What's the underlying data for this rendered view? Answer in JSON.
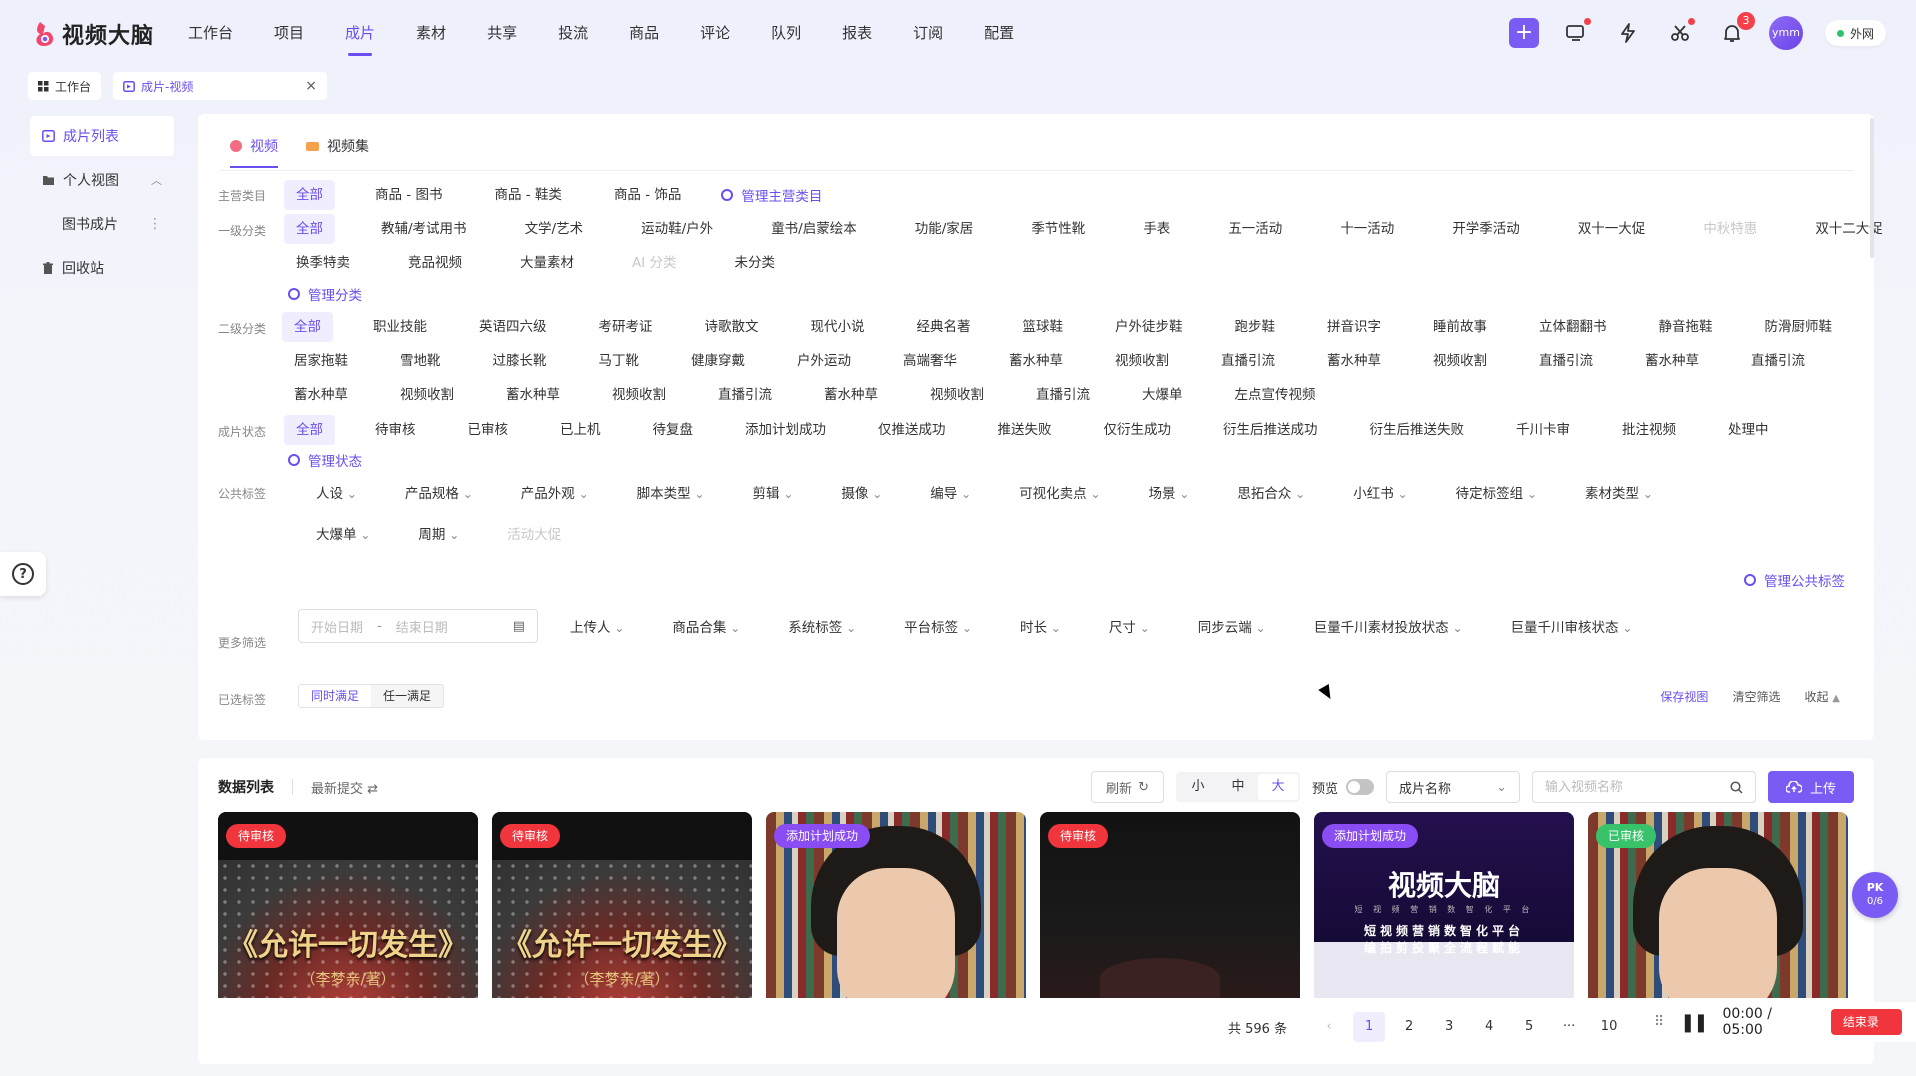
{
  "app": {
    "logo_text": "视频大脑"
  },
  "nav": [
    "工作台",
    "项目",
    "成片",
    "素材",
    "共享",
    "投流",
    "商品",
    "评论",
    "队列",
    "报表",
    "订阅",
    "配置"
  ],
  "nav_active": 2,
  "top": {
    "notif_count": "3",
    "avatar": "ymm",
    "network": "外网"
  },
  "tabs": [
    {
      "label": "工作台"
    },
    {
      "label": "成片-视频"
    }
  ],
  "sidebar": {
    "items": [
      {
        "label": "成片列表"
      },
      {
        "label": "个人视图"
      },
      {
        "label": "图书成片"
      },
      {
        "label": "回收站"
      }
    ]
  },
  "view_tabs": [
    "视频",
    "视频集"
  ],
  "filters": {
    "main_category": {
      "label": "主营类目",
      "options": [
        "全部",
        "商品 - 图书",
        "商品 - 鞋类",
        "商品 - 饰品"
      ],
      "manage": "管理主营类目"
    },
    "level1": {
      "label": "一级分类",
      "options": [
        "全部",
        "教辅/考试用书",
        "文学/艺术",
        "运动鞋/户外",
        "童书/启蒙绘本",
        "功能/家居",
        "季节性靴",
        "手表",
        "五一活动",
        "十一活动",
        "开学季活动",
        "双十一大促",
        "中秋特惠",
        "双十二大促",
        "换季特卖",
        "竞品视频",
        "大量素材",
        "AI 分类",
        "未分类"
      ],
      "manage": "管理分类"
    },
    "level2": {
      "label": "二级分类",
      "options": [
        "全部",
        "职业技能",
        "英语四六级",
        "考研考证",
        "诗歌散文",
        "现代小说",
        "经典名著",
        "篮球鞋",
        "户外徒步鞋",
        "跑步鞋",
        "拼音识字",
        "睡前故事",
        "立体翻翻书",
        "静音拖鞋",
        "防滑厨师鞋",
        "居家拖鞋",
        "雪地靴",
        "过膝长靴",
        "马丁靴",
        "健康穿戴",
        "户外运动",
        "高端奢华",
        "蓄水种草",
        "视频收割",
        "直播引流",
        "蓄水种草",
        "视频收割",
        "直播引流",
        "蓄水种草",
        "直播引流",
        "蓄水种草",
        "视频收割",
        "蓄水种草",
        "视频收割",
        "直播引流",
        "蓄水种草",
        "视频收割",
        "直播引流",
        "大爆单",
        "左点宣传视频"
      ]
    },
    "status": {
      "label": "成片状态",
      "options": [
        "全部",
        "待审核",
        "已审核",
        "已上机",
        "待复盘",
        "添加计划成功",
        "仅推送成功",
        "推送失败",
        "仅衍生成功",
        "衍生后推送成功",
        "衍生后推送失败",
        "千川卡审",
        "批注视频",
        "处理中"
      ],
      "manage": "管理状态"
    },
    "public_tags": {
      "label": "公共标签",
      "options": [
        "人设",
        "产品规格",
        "产品外观",
        "脚本类型",
        "剪辑",
        "摄像",
        "编导",
        "可视化卖点",
        "场景",
        "思拓合众",
        "小红书",
        "待定标签组",
        "素材类型",
        "大爆单",
        "周期",
        "活动大促"
      ],
      "manage": "管理公共标签"
    },
    "more": {
      "label": "更多筛选",
      "start_placeholder": "开始日期",
      "end_placeholder": "结束日期",
      "dash": "-",
      "options": [
        "上传人",
        "商品合集",
        "系统标签",
        "平台标签",
        "时长",
        "尺寸",
        "同步云端",
        "巨量千川素材投放状态",
        "巨量千川审核状态"
      ]
    },
    "selected": {
      "label": "已选标签",
      "modes": [
        "同时满足",
        "任一满足"
      ],
      "save": "保存视图",
      "clear": "清空筛选",
      "collapse": "收起"
    }
  },
  "list": {
    "title": "数据列表",
    "sort": "最新提交",
    "refresh": "刷新",
    "sizes": [
      "小",
      "中",
      "大"
    ],
    "preview": "预览",
    "field_select": "成片名称",
    "search_placeholder": "输入视频名称",
    "upload": "上传",
    "cards": [
      {
        "tag": "待审核",
        "title": "《允许一切发生》",
        "sub": "（李梦亲/著）"
      },
      {
        "tag": "待审核",
        "title": "《允许一切发生》",
        "sub": "（李梦亲/著）"
      },
      {
        "tag": "添加计划成功"
      },
      {
        "tag": "待审核"
      },
      {
        "tag": "添加计划成功",
        "logo": "视频大脑",
        "logo_sub": "短 视 频 营 销 数 智 化 平 台",
        "line1": "短视频营销数智化平台",
        "line2": "编拍剪投聚全流程赋能"
      },
      {
        "tag": "已审核"
      }
    ]
  },
  "pager": {
    "total": "共 596 条",
    "pages": [
      "1",
      "2",
      "3",
      "4",
      "5",
      "···",
      "10"
    ],
    "prev": "‹",
    "next": "›"
  },
  "recorder": {
    "time": "00:00 / 05:00",
    "end": "结束录制"
  },
  "pk": {
    "title": "PK",
    "value": "0/6"
  }
}
